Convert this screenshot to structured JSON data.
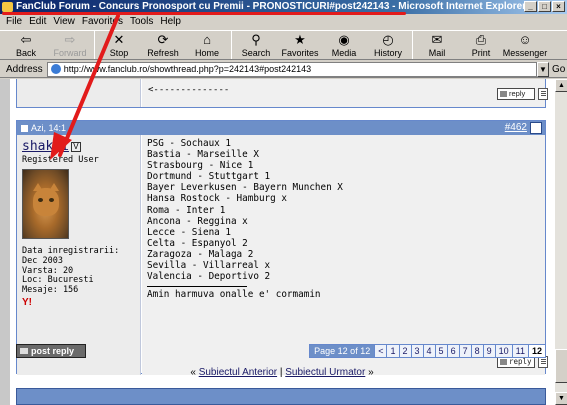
{
  "window": {
    "title": "FanClub Forum - Concurs Pronosport cu Premii - PRONOSTICURI#post242143 - Microsoft Internet Explorer",
    "min": "_",
    "max": "□",
    "close": "×"
  },
  "menu": [
    "File",
    "Edit",
    "View",
    "Favorites",
    "Tools",
    "Help"
  ],
  "toolbar": [
    {
      "label": "Back",
      "icon": "⇦",
      "name": "back-button",
      "disabled": false
    },
    {
      "label": "Forward",
      "icon": "⇨",
      "name": "forward-button",
      "disabled": true
    },
    {
      "label": "Stop",
      "icon": "✕",
      "name": "stop-button",
      "disabled": false
    },
    {
      "label": "Refresh",
      "icon": "⟳",
      "name": "refresh-button",
      "disabled": false
    },
    {
      "label": "Home",
      "icon": "⌂",
      "name": "home-button",
      "disabled": false
    },
    {
      "label": "Search",
      "icon": "⚲",
      "name": "search-button",
      "disabled": false
    },
    {
      "label": "Favorites",
      "icon": "★",
      "name": "favorites-button",
      "disabled": false
    },
    {
      "label": "Media",
      "icon": "◉",
      "name": "media-button",
      "disabled": false
    },
    {
      "label": "History",
      "icon": "◴",
      "name": "history-button",
      "disabled": false
    },
    {
      "label": "Mail",
      "icon": "✉",
      "name": "mail-button",
      "disabled": false
    },
    {
      "label": "Print",
      "icon": "⎙",
      "name": "print-button",
      "disabled": false
    },
    {
      "label": "Messenger",
      "icon": "☺",
      "name": "messenger-button",
      "disabled": false
    }
  ],
  "address": {
    "label": "Address",
    "url": "http://www.fanclub.ro/showthread.php?p=242143#post242143",
    "go": "Go"
  },
  "prev_post": {
    "text": "<--------------",
    "reply_label": "reply"
  },
  "post": {
    "date": "Azi, 14:1",
    "number": "#462",
    "username": "shakti",
    "badge": "V",
    "user_title": "Registered User",
    "join_label": "Data inregistrarii: Dec 2003",
    "age_label": "Varsta: 20",
    "location_label": "Loc: Bucuresti",
    "posts_label": "Mesaje: 156",
    "yahoo_icon": "Y!",
    "lines": [
      "PSG - Sochaux 1",
      "Bastia - Marseille X",
      "Strasbourg - Nice 1",
      "Dortmund - Stuttgart 1",
      "Bayer Leverkusen - Bayern Munchen X",
      "Hansa Rostock - Hamburg x",
      "Roma - Inter 1",
      "Ancona - Reggina x",
      "Lecce - Siena 1",
      "Celta - Espanyol 2",
      "Zaragoza - Malaga 2",
      "Sevilla - Villarreal x",
      "Valencia - Deportivo 2"
    ],
    "signature": "Amin harmuva onalle e' cormamin",
    "reply_label": "reply"
  },
  "post_reply_label": "post reply",
  "pager": {
    "info": "Page 12 of 12",
    "prev": "<",
    "pages": [
      "1",
      "2",
      "3",
      "4",
      "5",
      "6",
      "7",
      "8",
      "9",
      "10",
      "11",
      "12"
    ],
    "current": "12"
  },
  "nav": {
    "prev_marker": "«",
    "prev": "Subiectul Anterior",
    "separator": "|",
    "next": "Subiectul Urmator",
    "next_marker": "»"
  },
  "colors": {
    "annotation": "#e21b1b",
    "header": "#6d8fc8"
  }
}
